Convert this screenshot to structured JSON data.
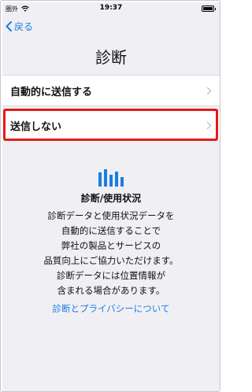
{
  "status_bar": {
    "carrier": "圏外",
    "time": "19:37"
  },
  "nav": {
    "back_label": "戻る"
  },
  "page": {
    "title": "診断"
  },
  "options": [
    {
      "label": "自動的に送信する"
    },
    {
      "label": "送信しない"
    }
  ],
  "info": {
    "title": "診断/使用状況",
    "lines": [
      "診断データと使用状況データを",
      "自動的に送信することで",
      "弊社の製品とサービスの",
      "品質向上にご協力いただけます。",
      "診断データには位置情報が",
      "含まれる場合があります。"
    ],
    "link": "診断とプライバシーについて"
  },
  "colors": {
    "accent": "#1a7ee3",
    "highlight": "#e21b1b",
    "background": "#efeff4"
  },
  "icons": {
    "info": "bar-chart-icon"
  }
}
